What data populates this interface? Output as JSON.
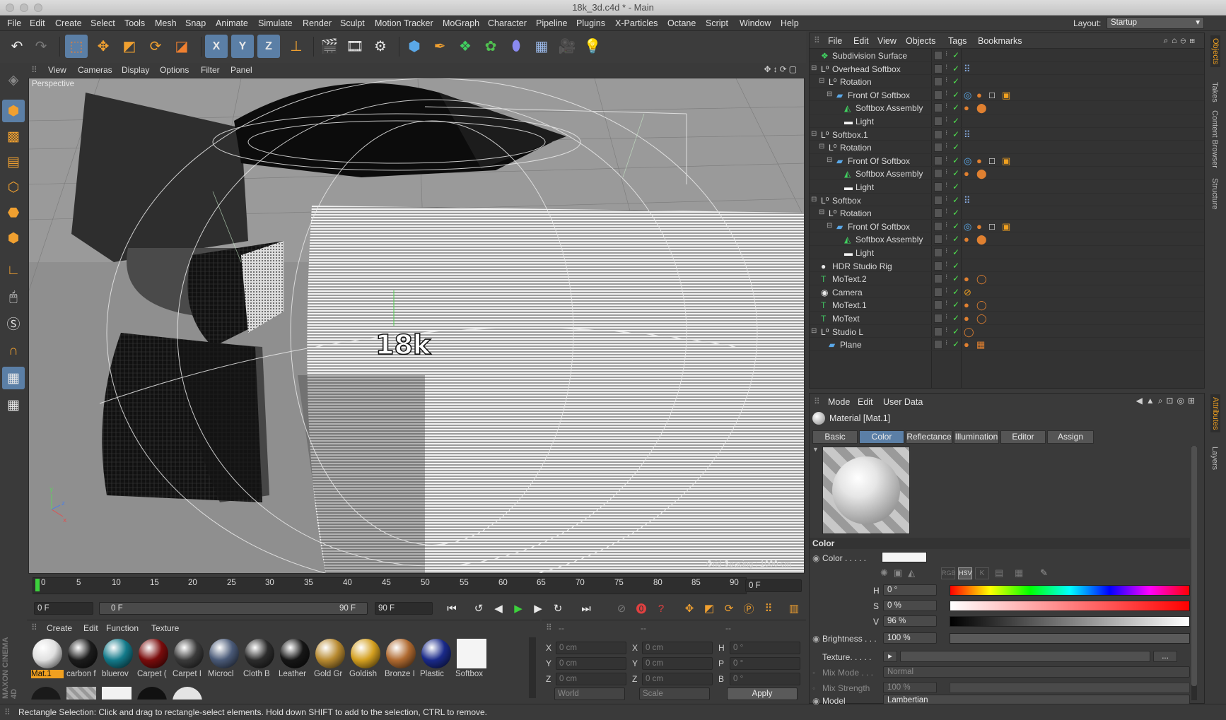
{
  "window": {
    "title": "18k_3d.c4d * - Main"
  },
  "menu": [
    "File",
    "Edit",
    "Create",
    "Select",
    "Tools",
    "Mesh",
    "Snap",
    "Animate",
    "Simulate",
    "Render",
    "Sculpt",
    "Motion Tracker",
    "MoGraph",
    "Character",
    "Pipeline",
    "Plugins",
    "X-Particles",
    "Octane",
    "Script",
    "Window",
    "Help"
  ],
  "layout": {
    "label": "Layout:",
    "value": "Startup"
  },
  "toolbar": {
    "x_label": "X",
    "y_label": "Y",
    "z_label": "Z"
  },
  "view_menu": [
    "View",
    "Cameras",
    "Display",
    "Options",
    "Filter",
    "Panel"
  ],
  "viewport": {
    "label": "Perspective",
    "grid_spacing": "Grid Spacing : 1000 cm",
    "logo_text": "18k",
    "axis_y": "y",
    "axis_z": "z",
    "axis_x": "x"
  },
  "timeline": {
    "ticks": [
      "0",
      "5",
      "10",
      "15",
      "20",
      "25",
      "30",
      "35",
      "40",
      "45",
      "50",
      "55",
      "60",
      "65",
      "70",
      "75",
      "80",
      "85",
      "90"
    ],
    "current_frame": "0 F",
    "start": "0 F",
    "range_start": "0 F",
    "range_end": "90 F",
    "end": "90 F"
  },
  "material_manager": {
    "menu": [
      "Create",
      "Edit",
      "Function",
      "Texture"
    ],
    "materials": [
      {
        "name": "Mat.1",
        "color": "#e0e0e0",
        "selected": true
      },
      {
        "name": "carbon f",
        "color": "#1c1c1c"
      },
      {
        "name": "bluerov",
        "color": "#137a8a"
      },
      {
        "name": "Carpet (",
        "color": "#7a0c0c"
      },
      {
        "name": "Carpet I",
        "color": "#3a3a3a"
      },
      {
        "name": "Microcl",
        "color": "#4a5a78"
      },
      {
        "name": "Cloth B",
        "color": "#2c2c2c"
      },
      {
        "name": "Leather",
        "color": "#161616"
      },
      {
        "name": "Gold Gr",
        "color": "#b88a30"
      },
      {
        "name": "Goldish",
        "color": "#d4a020"
      },
      {
        "name": "Bronze I",
        "color": "#b06a30"
      },
      {
        "name": "Plastic",
        "color": "#1a2a8a"
      },
      {
        "name": "Softbox",
        "color": "#f4f4f4"
      }
    ]
  },
  "coords": {
    "headers": [
      "--",
      "--",
      "--"
    ],
    "rows": [
      [
        "X",
        "0 cm",
        "X",
        "0 cm",
        "H",
        "0 °"
      ],
      [
        "Y",
        "0 cm",
        "Y",
        "0 cm",
        "P",
        "0 °"
      ],
      [
        "Z",
        "0 cm",
        "Z",
        "0 cm",
        "B",
        "0 °"
      ]
    ],
    "world": "World",
    "scale": "Scale",
    "apply": "Apply"
  },
  "status": "Rectangle Selection: Click and drag to rectangle-select elements. Hold down SHIFT to add to the selection, CTRL to remove.",
  "object_manager": {
    "menu": [
      "File",
      "Edit",
      "View",
      "Objects",
      "Tags",
      "Bookmarks"
    ],
    "objects": [
      {
        "name": "Subdivision Surface",
        "indent": 0,
        "icon": "subdivision-icon"
      },
      {
        "name": "Overhead Softbox",
        "indent": 0,
        "icon": "null-icon"
      },
      {
        "name": "Rotation",
        "indent": 1,
        "icon": "null-icon"
      },
      {
        "name": "Front Of Softbox",
        "indent": 2,
        "icon": "plane-icon"
      },
      {
        "name": "Softbox Assembly",
        "indent": 3,
        "icon": "mesh-icon"
      },
      {
        "name": "Light",
        "indent": 3,
        "icon": "light-icon"
      },
      {
        "name": "Softbox.1",
        "indent": 0,
        "icon": "null-icon"
      },
      {
        "name": "Rotation",
        "indent": 1,
        "icon": "null-icon"
      },
      {
        "name": "Front Of Softbox",
        "indent": 2,
        "icon": "plane-icon"
      },
      {
        "name": "Softbox Assembly",
        "indent": 3,
        "icon": "mesh-icon"
      },
      {
        "name": "Light",
        "indent": 3,
        "icon": "light-icon"
      },
      {
        "name": "Softbox",
        "indent": 0,
        "icon": "null-icon"
      },
      {
        "name": "Rotation",
        "indent": 1,
        "icon": "null-icon"
      },
      {
        "name": "Front Of Softbox",
        "indent": 2,
        "icon": "plane-icon"
      },
      {
        "name": "Softbox Assembly",
        "indent": 3,
        "icon": "mesh-icon"
      },
      {
        "name": "Light",
        "indent": 3,
        "icon": "light-icon"
      },
      {
        "name": "HDR Studio Rig",
        "indent": 0,
        "icon": "sphere-icon"
      },
      {
        "name": "MoText.2",
        "indent": 0,
        "icon": "text-icon"
      },
      {
        "name": "Camera",
        "indent": 0,
        "icon": "camera-icon"
      },
      {
        "name": "MoText.1",
        "indent": 0,
        "icon": "text-icon"
      },
      {
        "name": "MoText",
        "indent": 0,
        "icon": "text-icon"
      },
      {
        "name": "Studio L",
        "indent": 0,
        "icon": "null-icon"
      },
      {
        "name": "Plane",
        "indent": 1,
        "icon": "plane-icon"
      }
    ]
  },
  "attributes": {
    "menu": [
      "Mode",
      "Edit",
      "User Data"
    ],
    "title": "Material [Mat.1]",
    "tabs": [
      "Basic",
      "Color",
      "Reflectance",
      "Illumination",
      "Editor",
      "Assign"
    ],
    "active_tab": "Color",
    "section": "Color",
    "color_label": "Color . . . . .",
    "h_label": "H",
    "h_value": "0 °",
    "s_label": "S",
    "s_value": "0 %",
    "v_label": "V",
    "v_value": "96 %",
    "brightness_label": "Brightness . . .",
    "brightness_value": "100 %",
    "texture_label": "Texture. . . . .",
    "texture_more": "...",
    "mix_mode_label": "Mix Mode . . .",
    "mix_mode_value": "Normal",
    "mix_strength_label": "Mix Strength",
    "mix_strength_value": "100 %",
    "model_label": "Model",
    "model_value": "Lambertian",
    "mode_rgb": "RGB",
    "mode_hsv": "HSV",
    "mode_k": "K"
  },
  "right_tabs": [
    "Objects",
    "Takes",
    "Content Browser",
    "Structure",
    "Attributes",
    "Layers"
  ],
  "colors": {
    "accent": "#5b7fa6",
    "selected_material": "#f0a020",
    "check": "#4ee04e"
  }
}
